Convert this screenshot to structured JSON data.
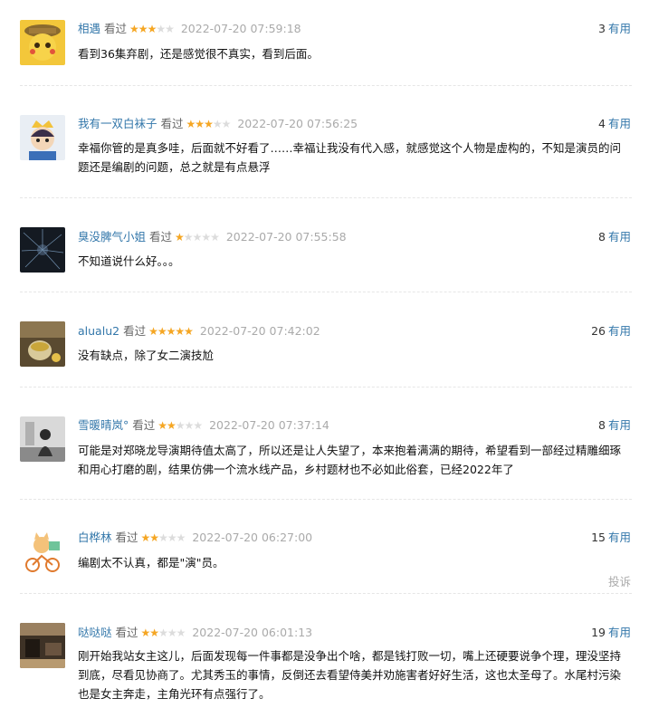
{
  "status_label": "看过",
  "vote_label": "有用",
  "report_label": "投诉",
  "colors": {
    "link": "#3377aa",
    "star_on": "#f5a623",
    "star_off": "#dcdcdc",
    "time": "#aaaaaa"
  },
  "comments": [
    {
      "username": "相遇",
      "rating": 3,
      "time": "2022-07-20 07:59:18",
      "votes": "3",
      "text": "看到36集弃剧，还是感觉很不真实，看到后面。",
      "avatar_icon": "cartoon-detective-avatar-icon"
    },
    {
      "username": "我有一双白袜子",
      "rating": 3,
      "time": "2022-07-20 07:56:25",
      "votes": "4",
      "text": "幸福你管的是真多哇，后面就不好看了……幸福让我没有代入感，就感觉这个人物是虚构的，不知是演员的问题还是编剧的问题，总之就是有点悬浮",
      "avatar_icon": "cartoon-prince-avatar-icon"
    },
    {
      "username": "臭没脾气小姐",
      "rating": 1,
      "time": "2022-07-20 07:55:58",
      "votes": "8",
      "text": "不知道说什么好。。。",
      "avatar_icon": "dark-night-sky-avatar-icon"
    },
    {
      "username": "alualu2",
      "rating": 5,
      "time": "2022-07-20 07:42:02",
      "votes": "26",
      "text": "没有缺点，除了女二演技尬",
      "avatar_icon": "tea-cup-avatar-icon"
    },
    {
      "username": "雪暖晴岚°",
      "rating": 2,
      "time": "2022-07-20 07:37:14",
      "votes": "8",
      "text": "可能是对郑晓龙导演期待值太高了，所以还是让人失望了，本来抱着满满的期待，希望看到一部经过精雕细琢和用心打磨的剧，结果仿佛一个流水线产品，乡村题材也不必如此俗套，已经2022年了",
      "avatar_icon": "grayscale-girl-avatar-icon"
    },
    {
      "username": "白桦林",
      "rating": 2,
      "time": "2022-07-20 06:27:00",
      "votes": "15",
      "text": "编剧太不认真，都是\"演\"员。",
      "avatar_icon": "cartoon-cat-bike-avatar-icon",
      "report": true
    },
    {
      "username": "哒哒哒",
      "rating": 2,
      "time": "2022-07-20 06:01:13",
      "votes": "19",
      "text": "刚开始我站女主这儿，后面发现每一件事都是没争出个啥，都是钱打败一切，嘴上还硬要说争个理，理没坚持到底，尽看见协商了。尤其秀玉的事情，反倒还去看望侍美并劝施害者好好生活，这也太圣母了。水尾村污染也是女主奔走，主角光环有点强行了。",
      "avatar_icon": "cafe-interior-avatar-icon"
    }
  ]
}
